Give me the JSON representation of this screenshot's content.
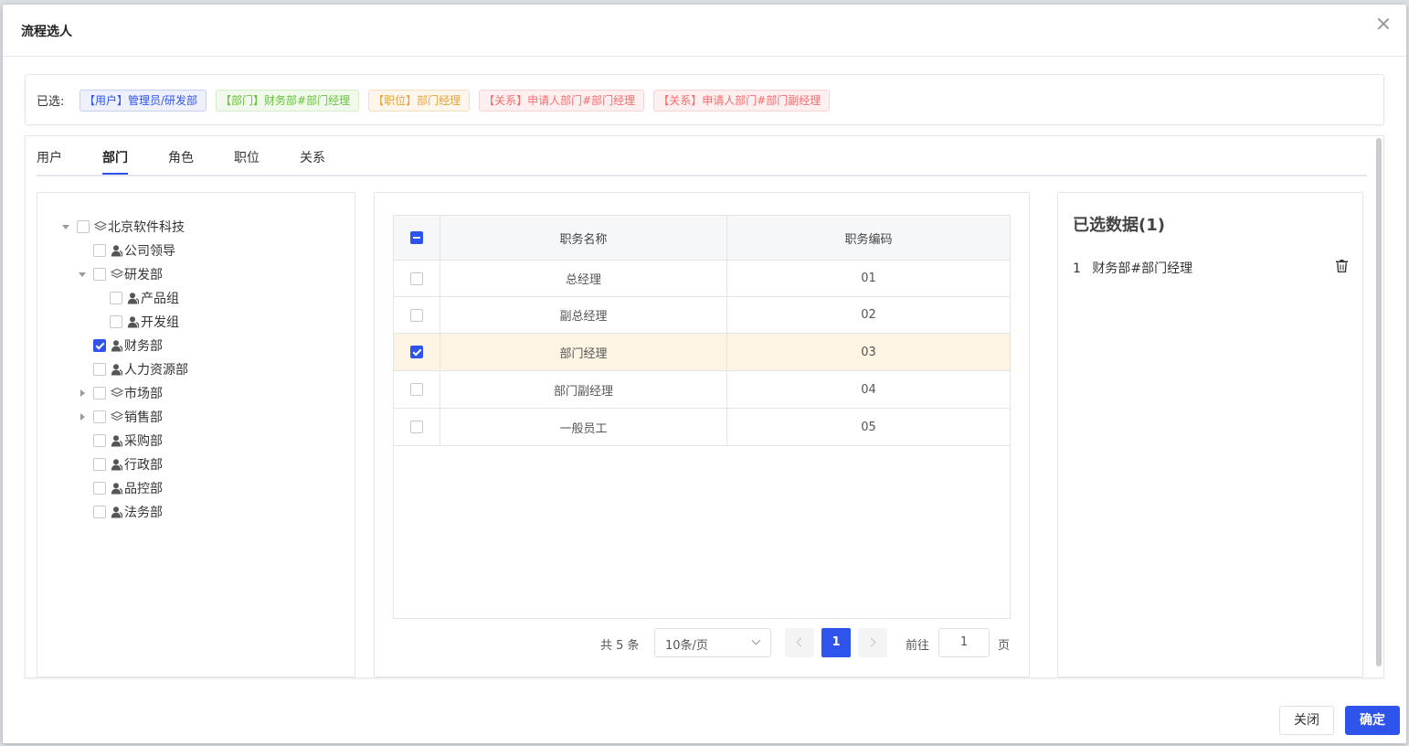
{
  "dialog": {
    "title": "流程选人"
  },
  "selected_bar": {
    "label": "已选:",
    "tags": [
      {
        "text": "【用户】管理员/研发部",
        "color": "#2f54eb"
      },
      {
        "text": "【部门】财务部#部门经理",
        "color": "#67c23a"
      },
      {
        "text": "【职位】部门经理",
        "color": "#e6a23c"
      },
      {
        "text": "【关系】申请人部门#部门经理",
        "color": "#f56c6c"
      },
      {
        "text": "【关系】申请人部门#部门副经理",
        "color": "#f56c6c"
      }
    ]
  },
  "tabs": [
    {
      "label": "用户"
    },
    {
      "label": "部门",
      "active": true
    },
    {
      "label": "角色"
    },
    {
      "label": "职位"
    },
    {
      "label": "关系"
    }
  ],
  "tree": [
    {
      "label": "北京软件科技",
      "icon": "layers-icon",
      "caret": "down",
      "checked": false
    },
    {
      "label": "公司领导",
      "icon": "user-icon",
      "checked": false
    },
    {
      "label": "研发部",
      "icon": "layers-icon",
      "caret": "down",
      "checked": false
    },
    {
      "label": "产品组",
      "icon": "user-icon",
      "checked": false
    },
    {
      "label": "开发组",
      "icon": "user-icon",
      "checked": false
    },
    {
      "label": "财务部",
      "icon": "user-icon",
      "checked": true
    },
    {
      "label": "人力资源部",
      "icon": "user-icon",
      "checked": false
    },
    {
      "label": "市场部",
      "icon": "layers-icon",
      "caret": "right",
      "checked": false
    },
    {
      "label": "销售部",
      "icon": "layers-icon",
      "caret": "right",
      "checked": false
    },
    {
      "label": "采购部",
      "icon": "user-icon",
      "checked": false
    },
    {
      "label": "行政部",
      "icon": "user-icon",
      "checked": false
    },
    {
      "label": "品控部",
      "icon": "user-icon",
      "checked": false
    },
    {
      "label": "法务部",
      "icon": "user-icon",
      "checked": false
    }
  ],
  "table": {
    "headers": [
      "职务名称",
      "职务编码"
    ],
    "rows": [
      {
        "name": "总经理",
        "code": "01",
        "checked": false
      },
      {
        "name": "副总经理",
        "code": "02",
        "checked": false
      },
      {
        "name": "部门经理",
        "code": "03",
        "checked": true
      },
      {
        "name": "部门副经理",
        "code": "04",
        "checked": false
      },
      {
        "name": "一般员工",
        "code": "05",
        "checked": false
      }
    ]
  },
  "pagination": {
    "total": "共 5 条",
    "page_size": "10条/页",
    "current": "1",
    "goto_label": "前往",
    "goto_value": "1",
    "page_unit": "页"
  },
  "selected_panel": {
    "title": "已选数据(1)",
    "items": [
      {
        "index": "1",
        "text": "财务部#部门经理"
      }
    ]
  },
  "footer": {
    "close_label": "关闭",
    "ok_label": "确定"
  },
  "colors": {
    "primary": "#2f54eb",
    "selected_row": "#fdf4e3"
  }
}
